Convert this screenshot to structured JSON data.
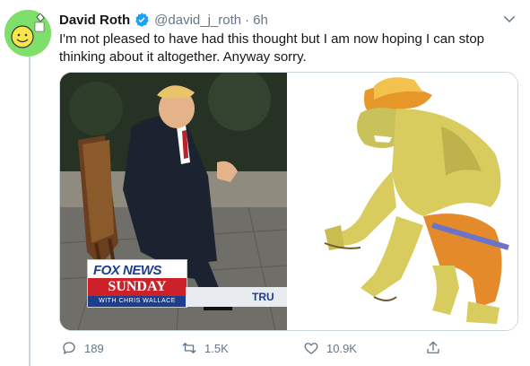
{
  "tweet": {
    "author_name": "David Roth",
    "handle": "@david_j_roth",
    "separator": "·",
    "time": "6h",
    "text": "I'm not pleased to have had this thought but I am now hoping I can stop thinking about it altogether. Anyway sorry."
  },
  "media": {
    "left_image": {
      "logo_title": "FOX NEWS",
      "logo_sub": "SUNDAY",
      "logo_host": "WITH CHRIS WALLACE",
      "banner_text": "TRU"
    }
  },
  "actions": {
    "reply_count": "189",
    "retweet_count": "1.5K",
    "like_count": "10.9K"
  },
  "colors": {
    "accent": "#1da1f2",
    "secondary_text": "#657786",
    "border": "#ccd6dd"
  }
}
